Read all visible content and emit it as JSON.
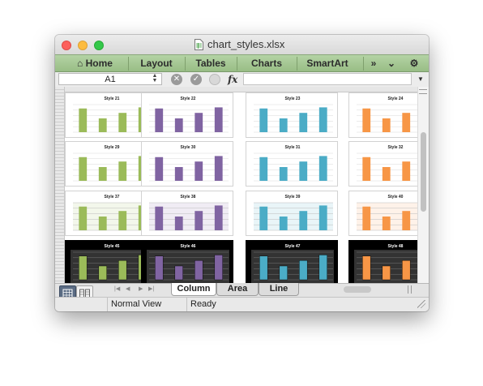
{
  "window": {
    "title": "chart_styles.xlsx",
    "doc_icon": "spreadsheet-document-icon"
  },
  "ribbon": {
    "tabs": [
      {
        "label": "Home",
        "icon": "home-icon"
      },
      {
        "label": "Layout"
      },
      {
        "label": "Tables"
      },
      {
        "label": "Charts"
      },
      {
        "label": "SmartArt"
      }
    ],
    "more_glyph": "»",
    "collapse_glyph": "⌄",
    "settings_glyph": "⚙"
  },
  "formula_bar": {
    "cell_ref": "A1",
    "cancel_glyph": "✕",
    "confirm_glyph": "✓",
    "fx_label": "fx",
    "formula": ""
  },
  "chart_data": [
    {
      "type": "bar",
      "title": "Style 21",
      "color": "#9bbb59",
      "values": [
        4.3,
        2.5,
        3.5,
        4.5
      ]
    },
    {
      "type": "bar",
      "title": "Style 22",
      "color": "#8064a2",
      "values": [
        4.3,
        2.5,
        3.5,
        4.5
      ]
    },
    {
      "type": "bar",
      "title": "Style 23",
      "color": "#4bacc6",
      "values": [
        4.3,
        2.5,
        3.5,
        4.5
      ]
    },
    {
      "type": "bar",
      "title": "Style 24",
      "color": "#f79646",
      "values": [
        4.3,
        2.5,
        3.5,
        4.5
      ]
    },
    {
      "type": "bar",
      "title": "Style 29",
      "color": "#9bbb59",
      "values": [
        4.3,
        2.5,
        3.5,
        4.5
      ]
    },
    {
      "type": "bar",
      "title": "Style 30",
      "color": "#8064a2",
      "values": [
        4.3,
        2.5,
        3.5,
        4.5
      ]
    },
    {
      "type": "bar",
      "title": "Style 31",
      "color": "#4bacc6",
      "values": [
        4.3,
        2.5,
        3.5,
        4.5
      ]
    },
    {
      "type": "bar",
      "title": "Style 32",
      "color": "#f79646",
      "values": [
        4.3,
        2.5,
        3.5,
        4.5
      ]
    },
    {
      "type": "bar",
      "title": "Style 37",
      "color": "#9bbb59",
      "values": [
        4.3,
        2.5,
        3.5,
        4.5
      ]
    },
    {
      "type": "bar",
      "title": "Style 38",
      "color": "#8064a2",
      "values": [
        4.3,
        2.5,
        3.5,
        4.5
      ]
    },
    {
      "type": "bar",
      "title": "Style 39",
      "color": "#4bacc6",
      "values": [
        4.3,
        2.5,
        3.5,
        4.5
      ]
    },
    {
      "type": "bar",
      "title": "Style 40",
      "color": "#f79646",
      "values": [
        4.3,
        2.5,
        3.5,
        4.5
      ]
    },
    {
      "type": "bar",
      "title": "Style 45",
      "color": "#9bbb59",
      "values": [
        4.3,
        2.5,
        3.5,
        4.5
      ]
    },
    {
      "type": "bar",
      "title": "Style 46",
      "color": "#8064a2",
      "values": [
        4.3,
        2.5,
        3.5,
        4.5
      ]
    },
    {
      "type": "bar",
      "title": "Style 47",
      "color": "#4bacc6",
      "values": [
        4.3,
        2.5,
        3.5,
        4.5
      ]
    },
    {
      "type": "bar",
      "title": "Style 48",
      "color": "#f79646",
      "values": [
        4.3,
        2.5,
        3.5,
        4.5
      ]
    }
  ],
  "sheet_tabs": [
    "Column",
    "Area",
    "Line"
  ],
  "status": {
    "view": "Normal View",
    "state": "Ready"
  }
}
